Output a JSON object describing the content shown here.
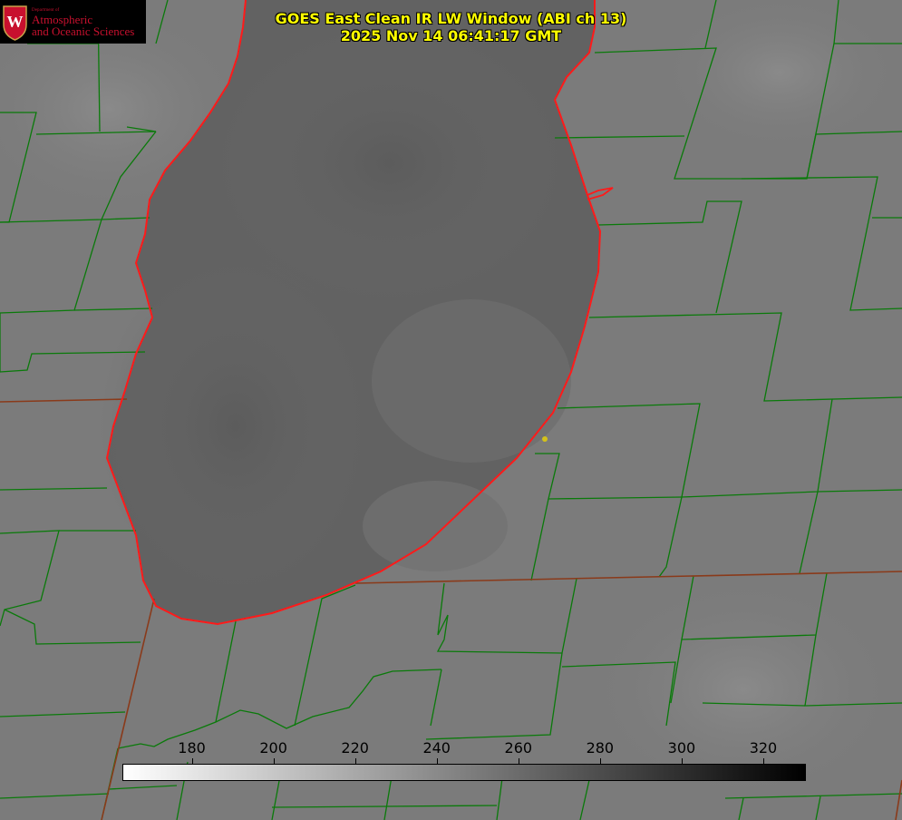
{
  "title": {
    "line1": "GOES East Clean IR LW Window (ABI ch 13)",
    "line2": "2025 Nov 14 06:41:17 GMT"
  },
  "logo": {
    "dept": "Department of",
    "line1": "Atmospheric",
    "line2": "and Oceanic Sciences",
    "seal_letter": "W"
  },
  "colorbar": {
    "min": 163,
    "max": 330,
    "ticks": [
      180,
      200,
      220,
      240,
      260,
      280,
      300,
      320
    ],
    "gradient_from": "#ffffff",
    "gradient_to": "#000000"
  },
  "colors": {
    "county_lines": "#0a7a0a",
    "lake_outline": "#ff1a1a",
    "state_border": "#8a3a1a",
    "marker": "#d4c21a",
    "title_text": "#ffff00",
    "logo_text": "#c8102e"
  }
}
